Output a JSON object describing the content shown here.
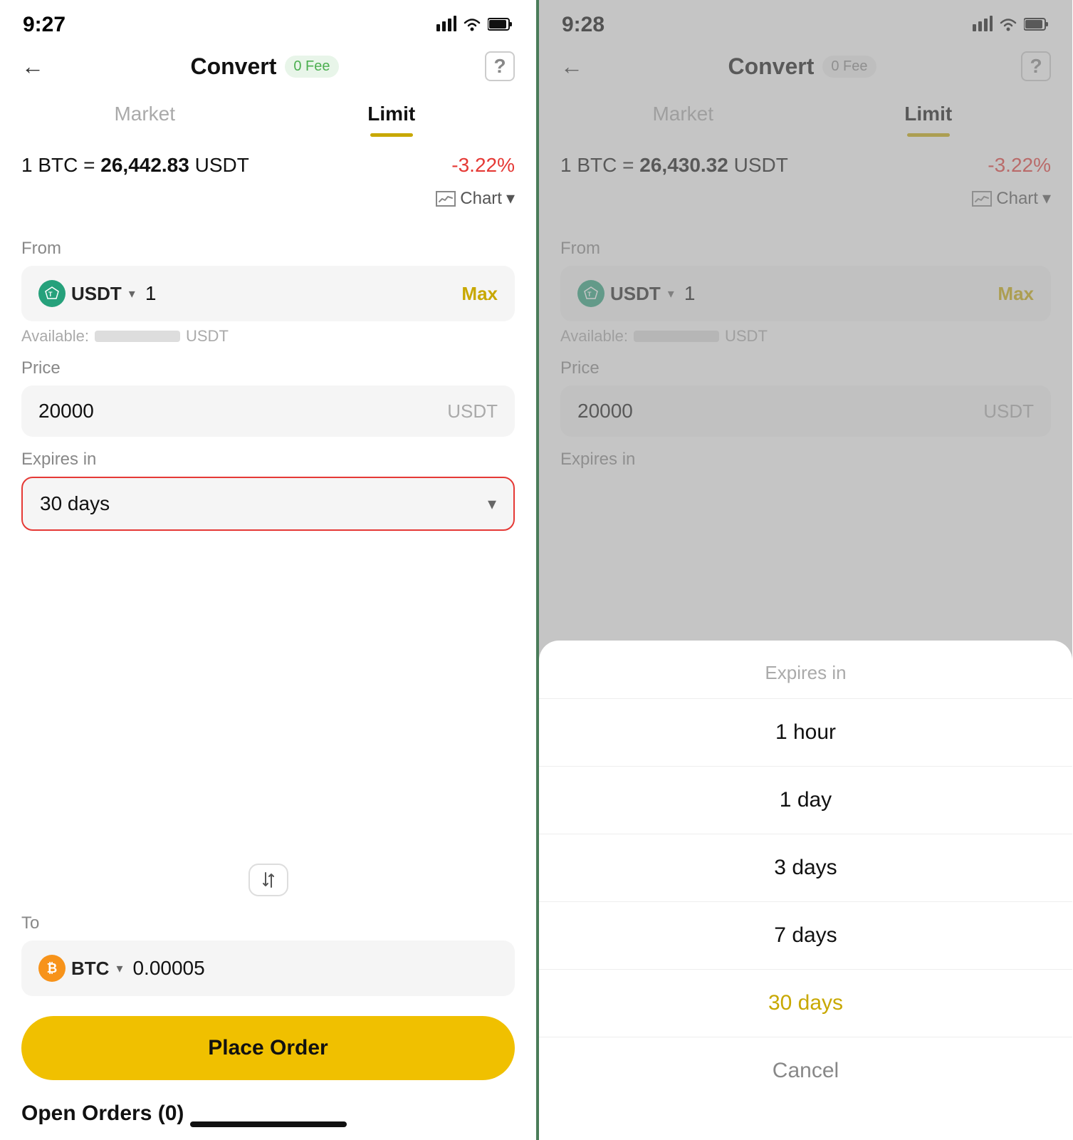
{
  "left": {
    "status": {
      "time": "9:27",
      "signal": "▋▊▉",
      "wifi": "wifi",
      "battery": "battery"
    },
    "header": {
      "back_label": "←",
      "title": "Convert",
      "fee_label": "0 Fee",
      "help_label": "?"
    },
    "tabs": {
      "market_label": "Market",
      "limit_label": "Limit",
      "active": "limit"
    },
    "rate": {
      "prefix": "1 BTC =",
      "value": "26,442.83",
      "suffix": "USDT",
      "change": "-3.22%"
    },
    "chart_label": "Chart",
    "from": {
      "label": "From",
      "coin": "USDT",
      "value": "1",
      "max_label": "Max",
      "available_label": "Available:",
      "available_unit": "USDT"
    },
    "price": {
      "label": "Price",
      "value": "20000",
      "unit": "USDT"
    },
    "expires": {
      "label": "Expires in",
      "value": "30 days"
    },
    "to": {
      "label": "To",
      "coin": "BTC",
      "value": "0.00005"
    },
    "place_order_label": "Place Order",
    "open_orders_label": "Open Orders (0)"
  },
  "right": {
    "status": {
      "time": "9:28"
    },
    "header": {
      "back_label": "←",
      "title": "Convert",
      "fee_label": "0 Fee",
      "help_label": "?"
    },
    "tabs": {
      "market_label": "Market",
      "limit_label": "Limit"
    },
    "rate": {
      "prefix": "1 BTC =",
      "value": "26,430.32",
      "suffix": "USDT",
      "change": "-3.22%"
    },
    "chart_label": "Chart",
    "from": {
      "label": "From",
      "coin": "USDT",
      "value": "1",
      "max_label": "Max",
      "available_label": "Available:",
      "available_unit": "USDT"
    },
    "price": {
      "label": "Price",
      "value": "20000",
      "unit": "USDT"
    },
    "expires": {
      "label": "Expires in"
    },
    "sheet": {
      "title": "Expires in",
      "items": [
        {
          "label": "1 hour",
          "active": false
        },
        {
          "label": "1 day",
          "active": false
        },
        {
          "label": "3 days",
          "active": false
        },
        {
          "label": "7 days",
          "active": false
        },
        {
          "label": "30 days",
          "active": true
        },
        {
          "label": "Cancel",
          "cancel": true
        }
      ]
    }
  }
}
